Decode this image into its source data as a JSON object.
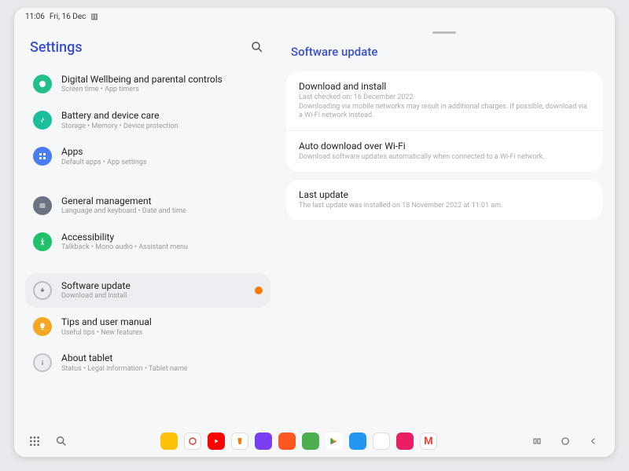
{
  "status": {
    "time": "11:06",
    "date": "Fri, 16 Dec"
  },
  "sidebar": {
    "title": "Settings",
    "items": [
      {
        "title": "Digital Wellbeing and parental controls",
        "subtitle": "Screen time • App timers",
        "color": "#21c08b",
        "icon": "wellbeing"
      },
      {
        "title": "Battery and device care",
        "subtitle": "Storage • Memory • Device protection",
        "color": "#1bbf9c",
        "icon": "care"
      },
      {
        "title": "Apps",
        "subtitle": "Default apps • App settings",
        "color": "#4a7cf6",
        "icon": "apps"
      }
    ],
    "items2": [
      {
        "title": "General management",
        "subtitle": "Language and keyboard • Date and time",
        "color": "#6b7280",
        "icon": "general"
      },
      {
        "title": "Accessibility",
        "subtitle": "Talkback • Mono audio • Assistant menu",
        "color": "#21c06b",
        "icon": "accessibility"
      }
    ],
    "items3": [
      {
        "title": "Software update",
        "subtitle": "Download and install",
        "color": "#a9adb8",
        "icon": "update",
        "selected": true,
        "badge": true
      },
      {
        "title": "Tips and user manual",
        "subtitle": "Useful tips • New features",
        "color": "#f5a623",
        "icon": "tips"
      },
      {
        "title": "About tablet",
        "subtitle": "Status • Legal information • Tablet name",
        "color": "#b8bcc4",
        "icon": "about"
      }
    ]
  },
  "panel": {
    "title": "Software update",
    "card1": [
      {
        "title": "Download and install",
        "sub1": "Last checked on: 16 December 2022",
        "sub2": "Downloading via mobile networks may result in additional charges. If possible, download via a Wi-Fi network instead."
      },
      {
        "title": "Auto download over Wi-Fi",
        "sub1": "Download software updates automatically when connected to a Wi-Fi network."
      }
    ],
    "card2": [
      {
        "title": "Last update",
        "sub1": "The last update was installed on 18 November 2022 at 11:01 am."
      }
    ]
  }
}
